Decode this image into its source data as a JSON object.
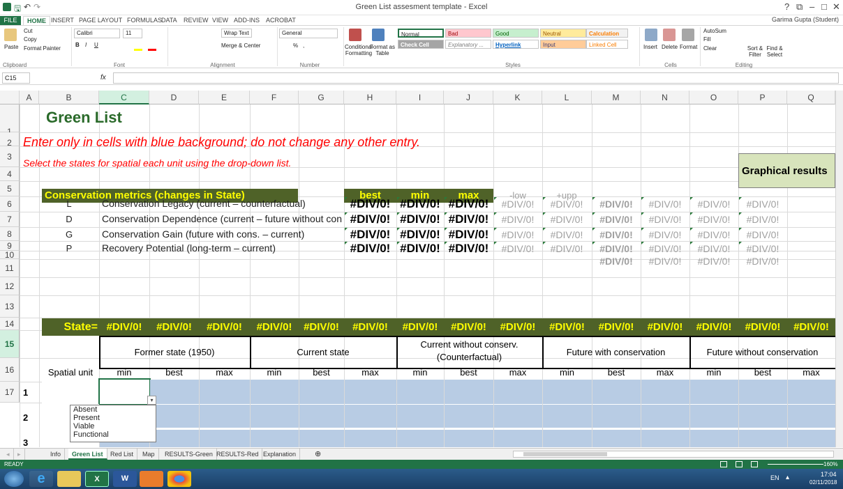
{
  "window": {
    "title": "Green List assesment template - Excel",
    "help": "?",
    "restore": "⧉",
    "minimize": "–",
    "maximize": "□",
    "close": "✕"
  },
  "tabs": [
    "FILE",
    "HOME",
    "INSERT",
    "PAGE LAYOUT",
    "FORMULAS",
    "DATA",
    "REVIEW",
    "VIEW",
    "ADD-INS",
    "ACROBAT"
  ],
  "user": "Garima Gupta (Student)",
  "ribbon": {
    "clipboard": {
      "paste": "Paste",
      "cut": "Cut",
      "copy": "Copy",
      "format_painter": "Format Painter",
      "label": "Clipboard"
    },
    "font": {
      "name": "Calibri",
      "size": "11",
      "label": "Font",
      "bold": "B",
      "italic": "I",
      "underline": "U"
    },
    "alignment": {
      "wrap": "Wrap Text",
      "merge": "Merge & Center",
      "label": "Alignment"
    },
    "number": {
      "format": "General",
      "percent": "%",
      "comma": ",",
      "label": "Number"
    },
    "styles": {
      "conditional": "Conditional Formatting",
      "format_table": "Format as Table",
      "normal": "Normal",
      "bad": "Bad",
      "good": "Good",
      "neutral": "Neutral",
      "calculation": "Calculation",
      "check_cell": "Check Cell",
      "explanatory": "Explanatory ...",
      "hyperlink": "Hyperlink",
      "input": "Input",
      "linked_cell": "Linked Cell",
      "label": "Styles"
    },
    "cells": {
      "insert": "Insert",
      "delete": "Delete",
      "format": "Format",
      "label": "Cells"
    },
    "editing": {
      "autosum": "AutoSum",
      "fill": "Fill",
      "clear": "Clear",
      "sort": "Sort & Filter",
      "find": "Find & Select",
      "label": "Editing"
    }
  },
  "formula_bar": {
    "name_box": "C15",
    "fx": "fx",
    "value": ""
  },
  "colors": {
    "excel_green": "#217346",
    "banner_olive": "#4f6228",
    "state_yellow": "#ffff00",
    "blue_input": "#b8cce4",
    "graph_box": "#d8e4bc",
    "red_note": "#ff0000"
  },
  "columns": [
    "A",
    "B",
    "C",
    "D",
    "E",
    "F",
    "G",
    "H",
    "I",
    "J",
    "K",
    "L",
    "M",
    "N",
    "O",
    "P",
    "Q"
  ],
  "rows": [
    "1",
    "2",
    "3",
    "4",
    "5",
    "6",
    "7",
    "8",
    "9",
    "10",
    "11",
    "12",
    "13",
    "14",
    "15",
    "16",
    "17"
  ],
  "sheet": {
    "title": "Green List",
    "note1": "Enter only in cells with blue background; do not change any other entry.",
    "note2": "Select the states for spatial each unit using the drop-down list.",
    "graphical": "Graphical results",
    "metrics_header": "Conservation metrics (changes in State)",
    "metric_cols": [
      "best",
      "min",
      "max",
      "-low",
      "+upp"
    ],
    "metrics": [
      {
        "code": "L",
        "label": "Conservation Legacy (current – counterfactual)"
      },
      {
        "code": "D",
        "label": "Conservation Dependence (current – future without con"
      },
      {
        "code": "G",
        "label": "Conservation Gain (future with cons. – current)"
      },
      {
        "code": "P",
        "label": "Recovery Potential (long-term – current)"
      }
    ],
    "div": "#DIV/0!",
    "state_label": "State=",
    "periods": [
      "Former state (1950)",
      "Current state",
      "Current without conserv. (Counterfactual)",
      "Future with conservation",
      "Future without conservation"
    ],
    "sub": [
      "min",
      "best",
      "max"
    ],
    "spatial_unit": "Spatial unit",
    "units": [
      "1",
      "2",
      "3"
    ]
  },
  "dropdown": [
    "Absent",
    "Present",
    "Viable",
    "Functional"
  ],
  "sheet_tabs": [
    "Info",
    "Green List",
    "Red List",
    "Map",
    "RESULTS-Green",
    "RESULTS-Red",
    "Explanation"
  ],
  "add_sheet": "⊕",
  "status": {
    "ready": "READY",
    "zoom": "160%"
  },
  "clock": {
    "lang": "EN",
    "time": "17:04",
    "date": "02/11/2018"
  }
}
